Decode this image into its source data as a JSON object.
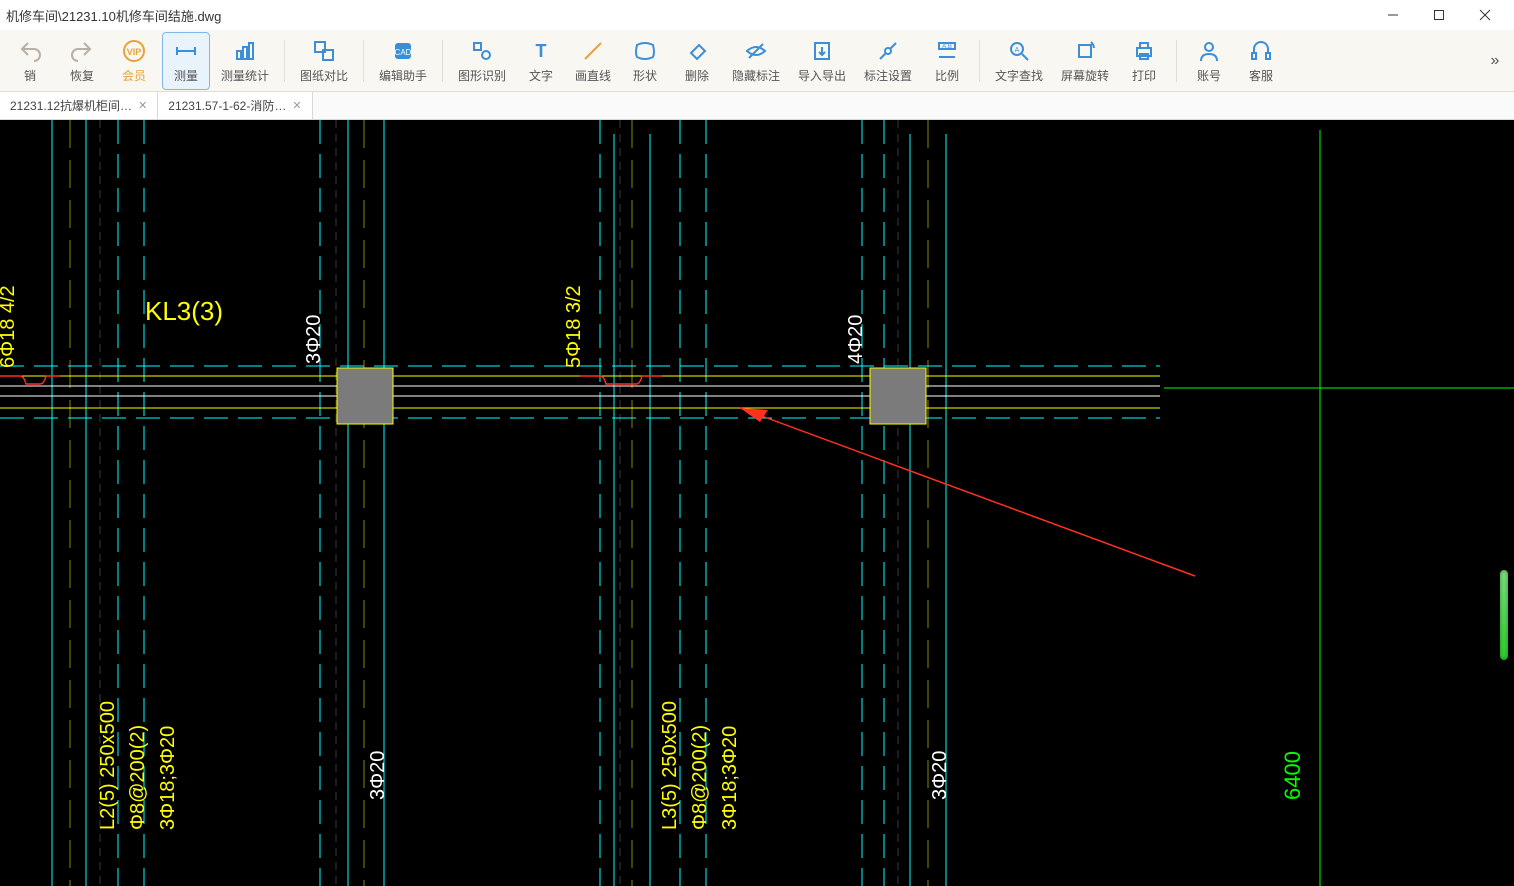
{
  "window": {
    "title": "机修车间\\21231.10机修车间结施.dwg"
  },
  "toolbar": {
    "undo": "销",
    "redo": "恢复",
    "vip": "会员",
    "measure": "测量",
    "measure_stat": "测量统计",
    "compare": "图纸对比",
    "edit_helper": "编辑助手",
    "shape_rec": "图形识别",
    "text": "文字",
    "line": "画直线",
    "shape": "形状",
    "delete": "删除",
    "hide_annot": "隐藏标注",
    "import_export": "导入导出",
    "annot_set": "标注设置",
    "scale": "比例",
    "find_text": "文字查找",
    "rotate": "屏幕旋转",
    "print": "打印",
    "account": "账号",
    "service": "客服"
  },
  "tabs": {
    "t1": "21231.12抗爆机柜间…",
    "t2": "21231.57-1-62-消防…"
  },
  "drawing": {
    "beam_label": "KL3(3)",
    "rebar_top_left": "6Φ18 4/2",
    "rebar_top_mid": "5Φ18 3/2",
    "col1": "3Φ20",
    "col2": "4Φ20",
    "col3": "3Φ20",
    "col4": "3Φ20",
    "beam_L2_1": "L2(5) 250x500",
    "beam_L2_2": "Φ8@200(2)",
    "beam_L2_3": "3Φ18;3Φ20",
    "beam_L3_1": "L3(5) 250x500",
    "beam_L3_2": "Φ8@200(2)",
    "beam_L3_3": "3Φ18;3Φ20",
    "dim_r": "6400"
  }
}
